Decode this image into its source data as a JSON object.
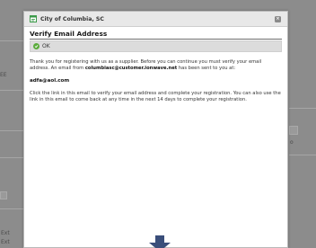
{
  "background": {
    "left_labels": [
      "EE",
      "Ext",
      "Ext"
    ],
    "right_label": "o"
  },
  "dialog": {
    "window_title": "City of Columbia, SC",
    "close_symbol": "×",
    "heading": "Verify Email Address",
    "status_label": "OK",
    "message_before": "Thank you for registering with us as a supplier. Before you can continue you must verify your email address. An email from ",
    "sender_email": "columbiasc@customer.ionwave.net",
    "message_after": " has been sent to you at:",
    "recipient_email": "adfa@aol.com",
    "instructions": "Click the link in this email to verify your email address and complete your registration. You can also use the link in this email to come back at any time in the next 14 days to complete your registration."
  },
  "colors": {
    "ok_green": "#5aab3b",
    "arrow_blue": "#3a4e7a",
    "app_icon_green": "#3c9a4a"
  },
  "icons": [
    "app-window-icon",
    "close-icon",
    "checkmark-icon",
    "arrow-down-icon"
  ]
}
